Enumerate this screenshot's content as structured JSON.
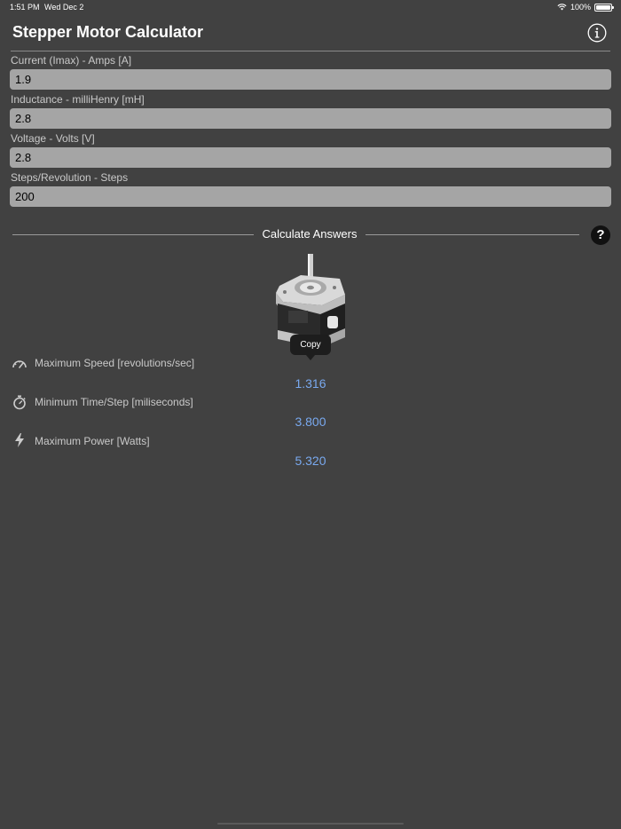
{
  "status_bar": {
    "time": "1:51 PM",
    "date": "Wed Dec 2",
    "battery": "100%"
  },
  "header": {
    "title": "Stepper Motor Calculator",
    "info_icon": "info-icon"
  },
  "inputs": {
    "current": {
      "label": "Current (Imax) - Amps [A]",
      "value": "1.9"
    },
    "inductance": {
      "label": "Inductance - milliHenry [mH]",
      "value": "2.8"
    },
    "voltage": {
      "label": "Voltage - Volts [V]",
      "value": "2.8"
    },
    "steps": {
      "label": "Steps/Revolution - Steps",
      "value": "200"
    }
  },
  "calculate": {
    "label": "Calculate Answers",
    "help_icon": "question-icon",
    "help_text": "?"
  },
  "tooltip": {
    "label": "Copy"
  },
  "results": {
    "speed": {
      "icon": "speedometer-icon",
      "label": "Maximum Speed [revolutions/sec]",
      "value": "1.316"
    },
    "time_step": {
      "icon": "stopwatch-icon",
      "label": "Minimum Time/Step [miliseconds]",
      "value": "3.800"
    },
    "power": {
      "icon": "lightning-bolt-icon",
      "label": "Maximum Power [Watts]",
      "value": "5.320"
    }
  },
  "colors": {
    "background": "#414141",
    "input_background": "#a5a5a5",
    "result_value": "#79a9ef",
    "label_text": "#c9c9c9"
  }
}
